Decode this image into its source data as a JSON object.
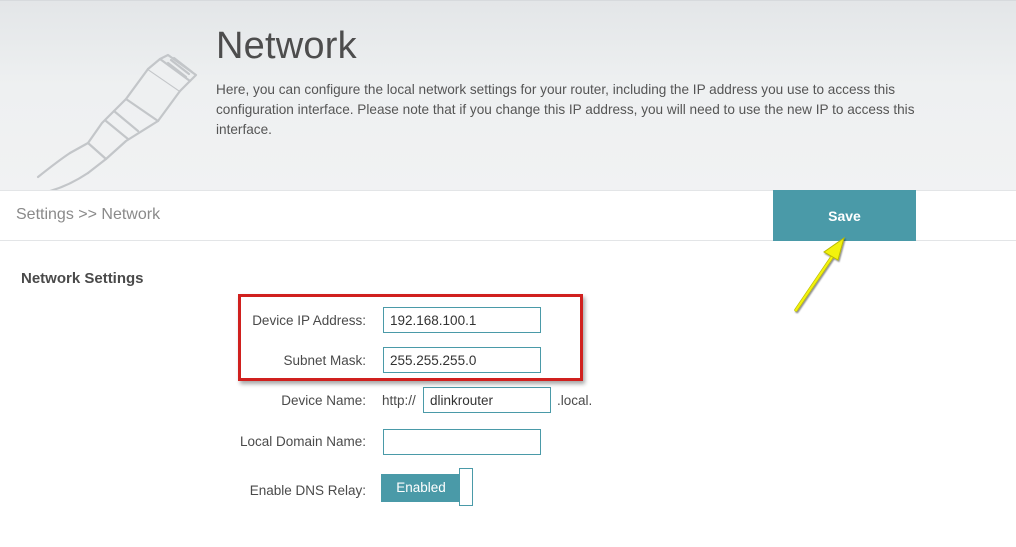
{
  "header": {
    "title": "Network",
    "description": "Here, you can configure the local network settings for your router, including the IP address you use to access this configuration interface. Please note that if you change this IP address, you will need to use the new IP to access this interface.",
    "illustration_icon": "ethernet-cable-icon"
  },
  "breadcrumb": {
    "text": "Settings >> Network"
  },
  "toolbar": {
    "save_label": "Save"
  },
  "section": {
    "title": "Network Settings"
  },
  "form": {
    "device_ip": {
      "label": "Device IP Address:",
      "value": "192.168.100.1"
    },
    "subnet_mask": {
      "label": "Subnet Mask:",
      "value": "255.255.255.0"
    },
    "device_name": {
      "label": "Device Name:",
      "prefix": "http://",
      "value": "dlinkrouter",
      "suffix": ".local."
    },
    "local_domain": {
      "label": "Local Domain Name:",
      "value": ""
    },
    "dns_relay": {
      "label": "Enable DNS Relay:",
      "state_label": "Enabled",
      "enabled": true
    }
  },
  "colors": {
    "accent": "#4a9aa8",
    "highlight_box": "#d0201e",
    "arrow": "#f2f20a"
  }
}
